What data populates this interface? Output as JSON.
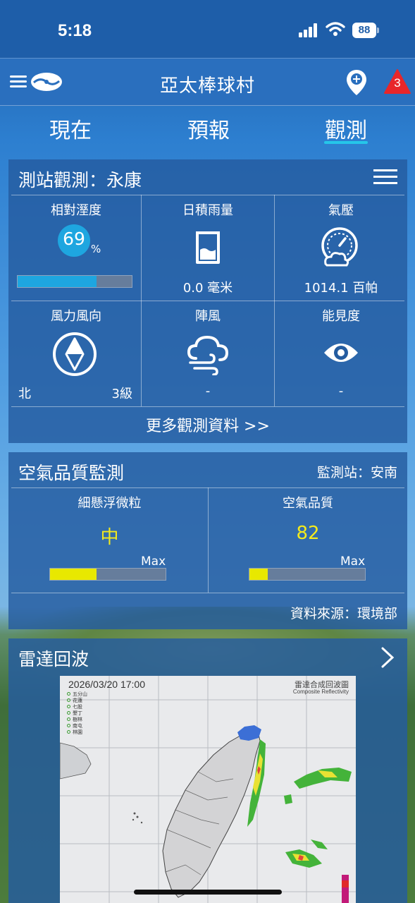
{
  "status": {
    "time": "5:18",
    "battery": "88"
  },
  "appbar": {
    "title": "亞太棒球村",
    "alert_count": "3"
  },
  "tabs": [
    "現在",
    "預報",
    "觀測"
  ],
  "active_tab": "觀測",
  "station": {
    "title": "測站觀測：永康",
    "humidity": {
      "label": "相對溼度",
      "value": "69",
      "unit": "%",
      "level": 0.69
    },
    "rain": {
      "label": "日積雨量",
      "value": "0.0 毫米"
    },
    "pressure": {
      "label": "氣壓",
      "value": "1014.1 百帕"
    },
    "wind": {
      "label": "風力風向",
      "direction": "北",
      "level": "3級"
    },
    "gust": {
      "label": "陣風",
      "value": "-"
    },
    "visibility": {
      "label": "能見度",
      "value": "-"
    },
    "more_link": "更多觀測資料 >>"
  },
  "air": {
    "title": "空氣品質監測",
    "station": "監測站：安南",
    "pm": {
      "label": "細懸浮微粒",
      "value": "中",
      "max_label": "Max",
      "level": 0.4
    },
    "aqi": {
      "label": "空氣品質",
      "value": "82",
      "max_label": "Max",
      "level": 0.16
    },
    "source": "資料來源：環境部",
    "value_color": "#f4ea1c"
  },
  "radar": {
    "title": "雷達回波",
    "timestamp": "2026/03/20  17:00",
    "map_title": "雷達合成回波圖",
    "map_subtitle": "Composite Reflectivity",
    "legend": [
      "五分山",
      "花蓮",
      "七股",
      "墾丁",
      "樹林",
      "南屯",
      "林園"
    ]
  },
  "colors": {
    "accent": "#25c6e9",
    "bar_blue": "#1ea6e0",
    "bar_yellow": "#e8e800"
  }
}
